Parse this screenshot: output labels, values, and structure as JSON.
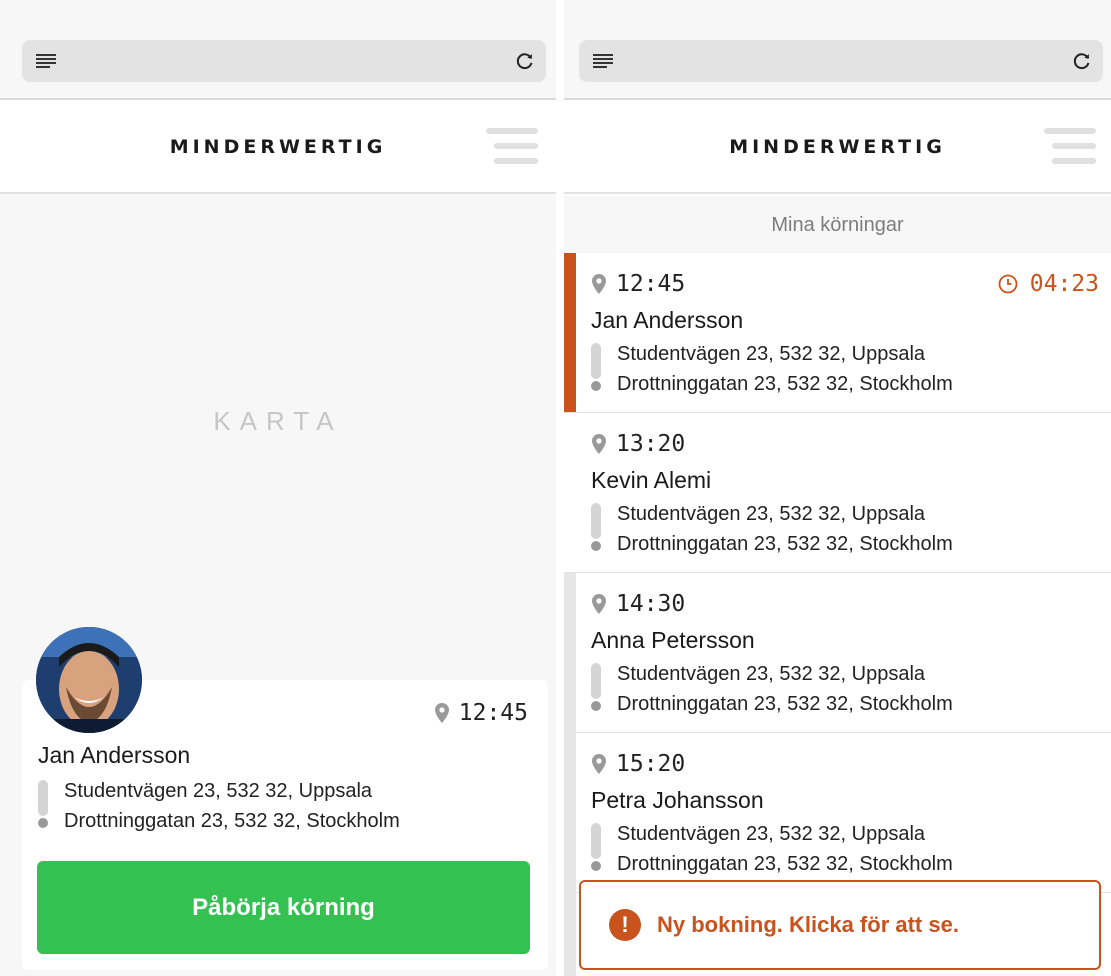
{
  "app": {
    "brand": "MINDERWERTIG"
  },
  "map": {
    "label": "KARTA"
  },
  "current_booking": {
    "time": "12:45",
    "name": "Jan Andersson",
    "from": "Studentvägen 23, 532 32, Uppsala",
    "to": "Drottninggatan 23, 532 32, Stockholm",
    "start_label": "Påbörja körning"
  },
  "rides": {
    "header": "Mina körningar",
    "items": [
      {
        "time": "12:45",
        "timer": "04:23",
        "name": "Jan Andersson",
        "from": "Studentvägen 23, 532 32, Uppsala",
        "to": "Drottninggatan 23, 532 32, Stockholm"
      },
      {
        "time": "13:20",
        "name": "Kevin Alemi",
        "from": "Studentvägen 23, 532 32, Uppsala",
        "to": "Drottninggatan 23, 532 32, Stockholm"
      },
      {
        "time": "14:30",
        "name": "Anna Petersson",
        "from": "Studentvägen 23, 532 32, Uppsala",
        "to": "Drottninggatan 23, 532 32, Stockholm"
      },
      {
        "time": "15:20",
        "name": "Petra Johansson",
        "from": "Studentvägen 23, 532 32, Uppsala",
        "to": "Drottninggatan 23, 532 32, Stockholm"
      }
    ]
  },
  "toast": {
    "icon": "!",
    "text": "Ny bokning. Klicka för att se."
  },
  "colors": {
    "accent": "#c8531d",
    "primary_button": "#35c152"
  },
  "icons": [
    "reader-icon",
    "reload-icon",
    "menu-icon",
    "pin-icon",
    "clock-icon",
    "alert-icon",
    "avatar"
  ]
}
